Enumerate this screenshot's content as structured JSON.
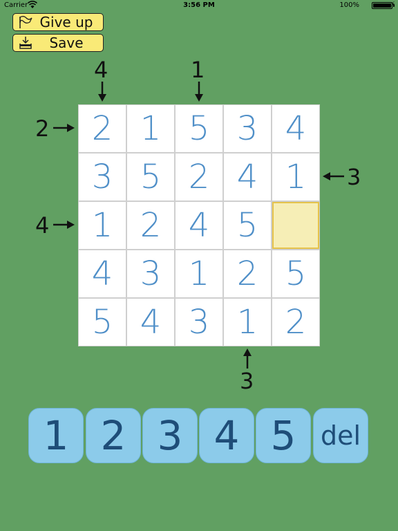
{
  "status": {
    "carrier": "Carrier",
    "time": "3:56 PM",
    "battery": "100%"
  },
  "buttons": {
    "give_up": "Give up",
    "save": "Save"
  },
  "board": {
    "cells": [
      [
        "2",
        "1",
        "5",
        "3",
        "4"
      ],
      [
        "3",
        "5",
        "2",
        "4",
        "1"
      ],
      [
        "1",
        "2",
        "4",
        "5",
        ""
      ],
      [
        "4",
        "3",
        "1",
        "2",
        "5"
      ],
      [
        "5",
        "4",
        "3",
        "1",
        "2"
      ]
    ],
    "selected": {
      "row": 2,
      "col": 4
    }
  },
  "clues": {
    "top": {
      "col0": "4",
      "col2": "1"
    },
    "left": {
      "row0": "2",
      "row2": "4"
    },
    "right": {
      "row1": "3"
    },
    "bottom": {
      "col3": "3"
    }
  },
  "keypad": [
    "1",
    "2",
    "3",
    "4",
    "5",
    "del"
  ],
  "colors": {
    "background": "#61a062",
    "digit": "#4f8fc8",
    "key": "#8ccbea",
    "button": "#f9ea77",
    "selected": "#f6eeb6"
  }
}
